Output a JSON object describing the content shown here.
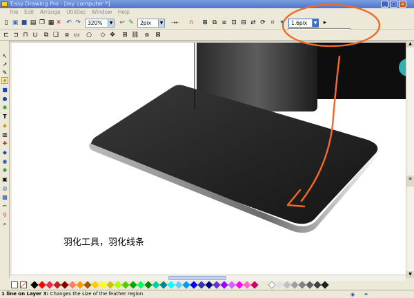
{
  "window": {
    "title": "Easy Drawing Pro - [my computer *]",
    "minimize": "_",
    "maximize": "□",
    "close": "×"
  },
  "menu": [
    "File",
    "Edit",
    "Arrange",
    "Utilities",
    "Window",
    "Help"
  ],
  "toolbar": {
    "zoom_value": "320%",
    "line_width_value": "2pix",
    "feather_value": "1.6pix"
  },
  "canvas": {
    "caption": "羽化工具，羽化线条"
  },
  "status": {
    "left": "1 line on Layer 3:",
    "message": "Changes the size of the feather region"
  },
  "colors": {
    "annotation": "#f06a28",
    "canvas": "#ffffff",
    "chrome": "#ece9d8"
  }
}
